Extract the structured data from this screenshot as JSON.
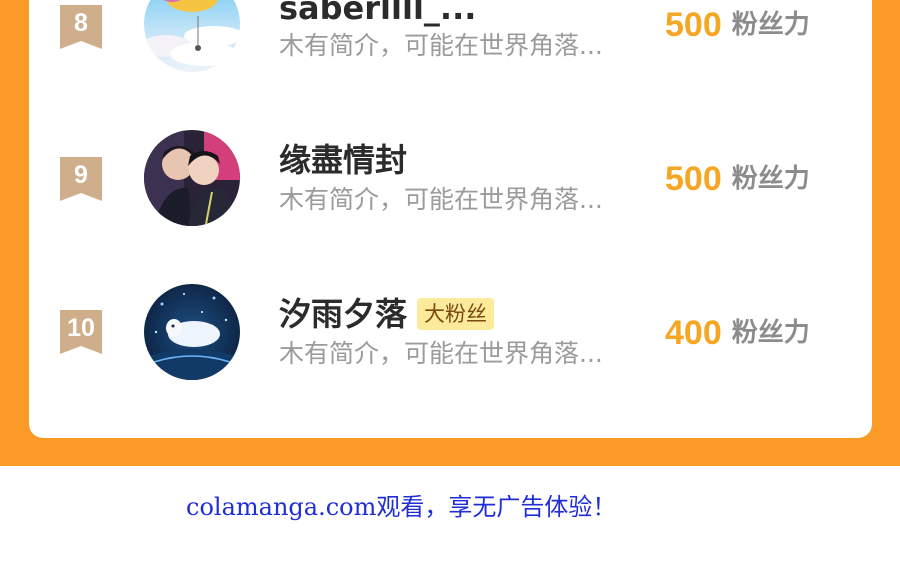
{
  "ranking": {
    "rows": [
      {
        "rank": "8",
        "name": "saberllll_...",
        "bio": "木有简介，可能在世界角落...",
        "score": "500",
        "score_unit": "粉丝力",
        "badge": null,
        "avatar_icon": "sky-balloon-avatar"
      },
      {
        "rank": "9",
        "name": "缘盡情封",
        "bio": "木有简介，可能在世界角落...",
        "score": "500",
        "score_unit": "粉丝力",
        "badge": null,
        "avatar_icon": "two-people-avatar"
      },
      {
        "rank": "10",
        "name": "汐雨夕落",
        "bio": "木有简介，可能在世界角落...",
        "score": "400",
        "score_unit": "粉丝力",
        "badge": "大粉丝",
        "avatar_icon": "night-whale-avatar"
      }
    ]
  },
  "footer": {
    "text": "colamanga.com观看，享无广告体验！"
  },
  "colors": {
    "background_orange": "#fb9a26",
    "score_gold": "#f5a623",
    "rank_badge_tan": "#cfae8c",
    "badge_yellow": "#fdeb9b",
    "footer_blue": "#1f2ed6"
  }
}
